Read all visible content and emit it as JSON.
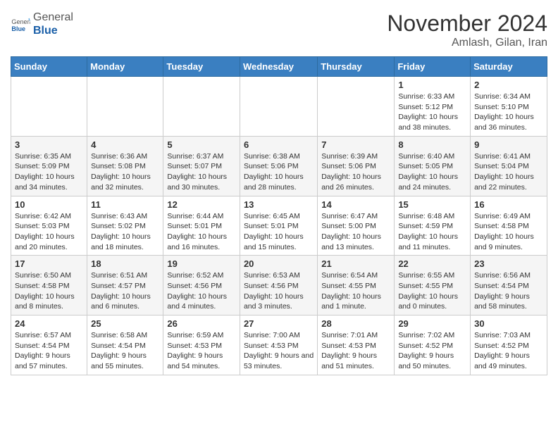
{
  "logo": {
    "general": "General",
    "blue": "Blue"
  },
  "title": "November 2024",
  "location": "Amlash, Gilan, Iran",
  "days_header": [
    "Sunday",
    "Monday",
    "Tuesday",
    "Wednesday",
    "Thursday",
    "Friday",
    "Saturday"
  ],
  "weeks": [
    [
      {
        "day": "",
        "detail": ""
      },
      {
        "day": "",
        "detail": ""
      },
      {
        "day": "",
        "detail": ""
      },
      {
        "day": "",
        "detail": ""
      },
      {
        "day": "",
        "detail": ""
      },
      {
        "day": "1",
        "detail": "Sunrise: 6:33 AM\nSunset: 5:12 PM\nDaylight: 10 hours and 38 minutes."
      },
      {
        "day": "2",
        "detail": "Sunrise: 6:34 AM\nSunset: 5:10 PM\nDaylight: 10 hours and 36 minutes."
      }
    ],
    [
      {
        "day": "3",
        "detail": "Sunrise: 6:35 AM\nSunset: 5:09 PM\nDaylight: 10 hours and 34 minutes."
      },
      {
        "day": "4",
        "detail": "Sunrise: 6:36 AM\nSunset: 5:08 PM\nDaylight: 10 hours and 32 minutes."
      },
      {
        "day": "5",
        "detail": "Sunrise: 6:37 AM\nSunset: 5:07 PM\nDaylight: 10 hours and 30 minutes."
      },
      {
        "day": "6",
        "detail": "Sunrise: 6:38 AM\nSunset: 5:06 PM\nDaylight: 10 hours and 28 minutes."
      },
      {
        "day": "7",
        "detail": "Sunrise: 6:39 AM\nSunset: 5:06 PM\nDaylight: 10 hours and 26 minutes."
      },
      {
        "day": "8",
        "detail": "Sunrise: 6:40 AM\nSunset: 5:05 PM\nDaylight: 10 hours and 24 minutes."
      },
      {
        "day": "9",
        "detail": "Sunrise: 6:41 AM\nSunset: 5:04 PM\nDaylight: 10 hours and 22 minutes."
      }
    ],
    [
      {
        "day": "10",
        "detail": "Sunrise: 6:42 AM\nSunset: 5:03 PM\nDaylight: 10 hours and 20 minutes."
      },
      {
        "day": "11",
        "detail": "Sunrise: 6:43 AM\nSunset: 5:02 PM\nDaylight: 10 hours and 18 minutes."
      },
      {
        "day": "12",
        "detail": "Sunrise: 6:44 AM\nSunset: 5:01 PM\nDaylight: 10 hours and 16 minutes."
      },
      {
        "day": "13",
        "detail": "Sunrise: 6:45 AM\nSunset: 5:01 PM\nDaylight: 10 hours and 15 minutes."
      },
      {
        "day": "14",
        "detail": "Sunrise: 6:47 AM\nSunset: 5:00 PM\nDaylight: 10 hours and 13 minutes."
      },
      {
        "day": "15",
        "detail": "Sunrise: 6:48 AM\nSunset: 4:59 PM\nDaylight: 10 hours and 11 minutes."
      },
      {
        "day": "16",
        "detail": "Sunrise: 6:49 AM\nSunset: 4:58 PM\nDaylight: 10 hours and 9 minutes."
      }
    ],
    [
      {
        "day": "17",
        "detail": "Sunrise: 6:50 AM\nSunset: 4:58 PM\nDaylight: 10 hours and 8 minutes."
      },
      {
        "day": "18",
        "detail": "Sunrise: 6:51 AM\nSunset: 4:57 PM\nDaylight: 10 hours and 6 minutes."
      },
      {
        "day": "19",
        "detail": "Sunrise: 6:52 AM\nSunset: 4:56 PM\nDaylight: 10 hours and 4 minutes."
      },
      {
        "day": "20",
        "detail": "Sunrise: 6:53 AM\nSunset: 4:56 PM\nDaylight: 10 hours and 3 minutes."
      },
      {
        "day": "21",
        "detail": "Sunrise: 6:54 AM\nSunset: 4:55 PM\nDaylight: 10 hours and 1 minute."
      },
      {
        "day": "22",
        "detail": "Sunrise: 6:55 AM\nSunset: 4:55 PM\nDaylight: 10 hours and 0 minutes."
      },
      {
        "day": "23",
        "detail": "Sunrise: 6:56 AM\nSunset: 4:54 PM\nDaylight: 9 hours and 58 minutes."
      }
    ],
    [
      {
        "day": "24",
        "detail": "Sunrise: 6:57 AM\nSunset: 4:54 PM\nDaylight: 9 hours and 57 minutes."
      },
      {
        "day": "25",
        "detail": "Sunrise: 6:58 AM\nSunset: 4:54 PM\nDaylight: 9 hours and 55 minutes."
      },
      {
        "day": "26",
        "detail": "Sunrise: 6:59 AM\nSunset: 4:53 PM\nDaylight: 9 hours and 54 minutes."
      },
      {
        "day": "27",
        "detail": "Sunrise: 7:00 AM\nSunset: 4:53 PM\nDaylight: 9 hours and 53 minutes."
      },
      {
        "day": "28",
        "detail": "Sunrise: 7:01 AM\nSunset: 4:53 PM\nDaylight: 9 hours and 51 minutes."
      },
      {
        "day": "29",
        "detail": "Sunrise: 7:02 AM\nSunset: 4:52 PM\nDaylight: 9 hours and 50 minutes."
      },
      {
        "day": "30",
        "detail": "Sunrise: 7:03 AM\nSunset: 4:52 PM\nDaylight: 9 hours and 49 minutes."
      }
    ]
  ]
}
